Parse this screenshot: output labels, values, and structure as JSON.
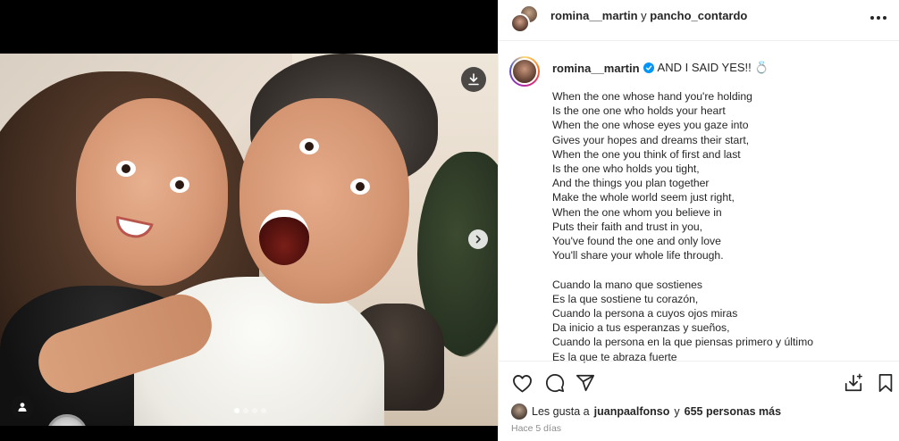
{
  "header": {
    "user1": "romina__martin",
    "conjunction": "y",
    "user2": "pancho_contardo"
  },
  "caption": {
    "username": "romina__martin",
    "headline": "AND I SAID YES!! 💍",
    "lines": [
      "When the one whose hand you're holding",
      "Is the one one who holds your heart",
      "When the one whose eyes you gaze into",
      "Gives your hopes and dreams their start,",
      "When the one you think of first and last",
      "Is the one who holds you tight,",
      "And the things you plan together",
      "Make the whole world seem just right,",
      "When the one whom you believe in",
      "Puts their faith and trust in you,",
      "You've found the one and only love",
      "You'll share your whole life through.",
      "",
      "Cuando la mano que sostienes",
      "Es la que sostiene tu corazón,",
      "Cuando la persona a cuyos ojos miras",
      "Da inicio a tus esperanzas y sueños,",
      "Cuando la persona en la que piensas primero y último",
      "Es la que te abraza fuerte"
    ]
  },
  "likes": {
    "prefix": "Les gusta a",
    "user": "juanpaalfonso",
    "conjunction": "y",
    "others": "655 personas más"
  },
  "time": "Hace 5 días",
  "icons": {
    "download": "download-icon",
    "next": "chevron-right-icon",
    "tag": "person-icon",
    "more": "more-horizontal-icon",
    "like": "heart-icon",
    "comment": "comment-icon",
    "share": "send-icon",
    "save_collection": "save-to-collection-icon",
    "save": "bookmark-icon"
  },
  "carousel": {
    "slides": 4,
    "active_index": 0
  }
}
